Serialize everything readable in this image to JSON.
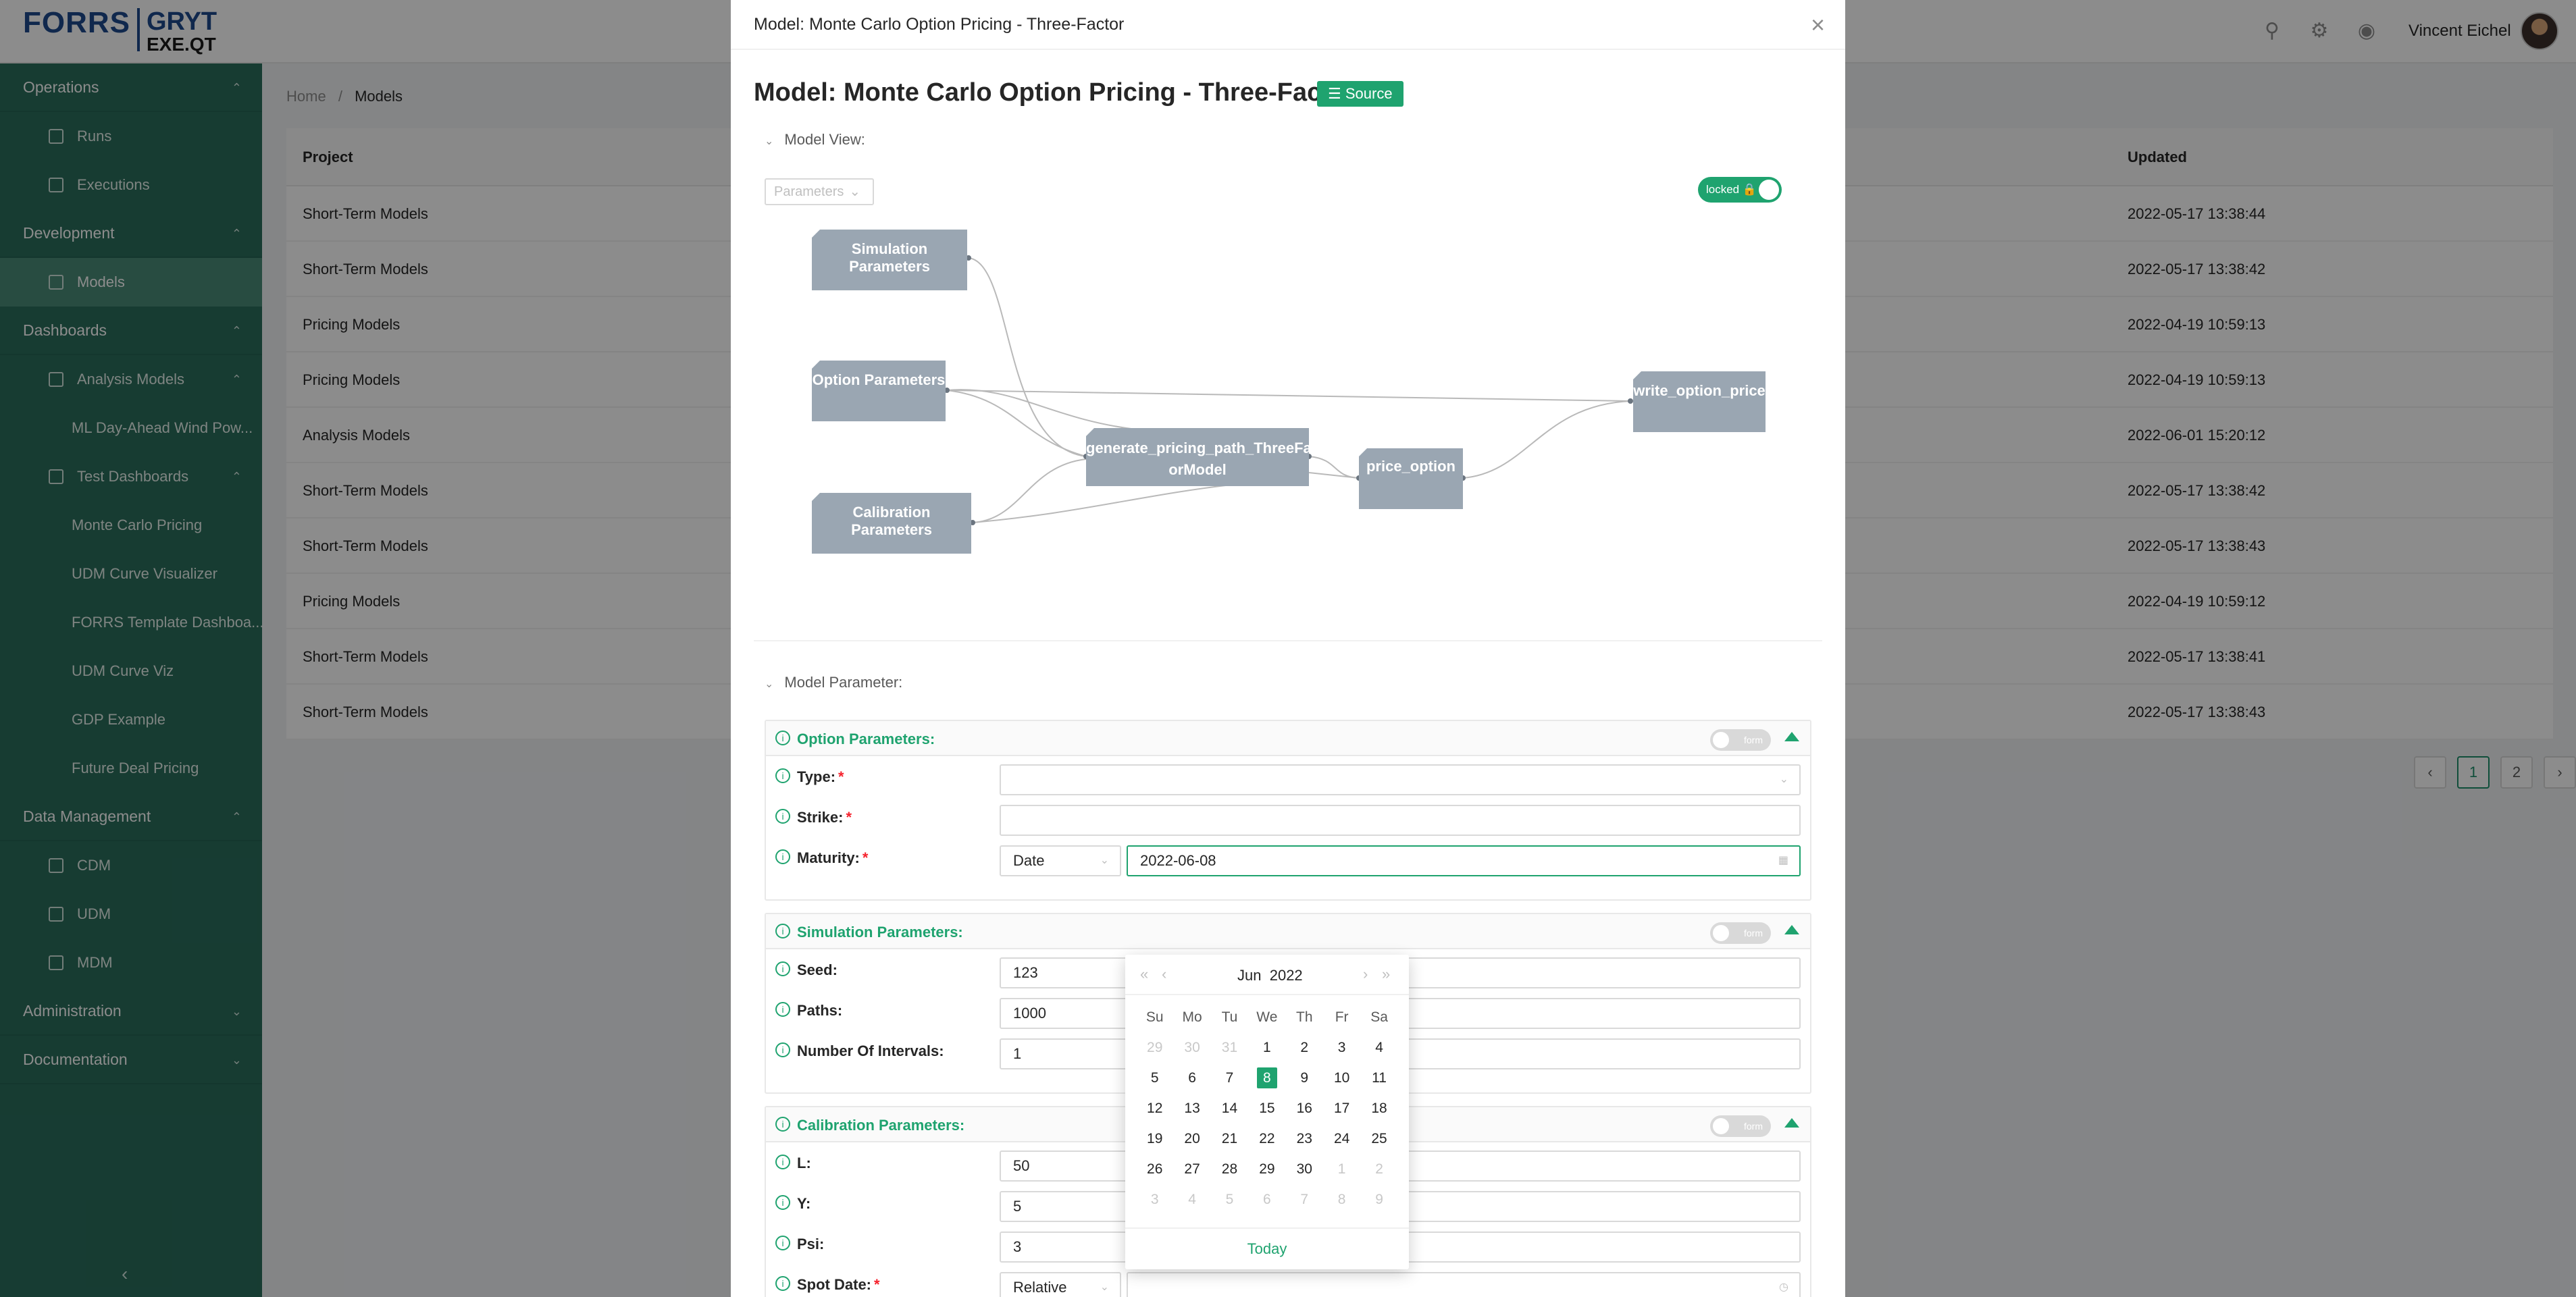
{
  "logo": {
    "brand": "FORRS",
    "sub1": "GRYT",
    "sub2": "EXE.QT"
  },
  "user": {
    "name": "Vincent Eichel"
  },
  "sidebar": {
    "operations": "Operations",
    "runs": "Runs",
    "executions": "Executions",
    "development": "Development",
    "models": "Models",
    "dashboards": "Dashboards",
    "analysis_models": "Analysis Models",
    "ml_wind": "ML Day-Ahead Wind Pow...",
    "test_dashboards": "Test Dashboards",
    "monte_carlo": "Monte Carlo Pricing",
    "udm_curve_visualizer": "UDM Curve Visualizer",
    "forrs_template": "FORRS Template Dashboa...",
    "udm_curve_viz": "UDM Curve Viz",
    "gdp_example": "GDP Example",
    "future_deal": "Future Deal Pricing",
    "data_management": "Data Management",
    "cdm": "CDM",
    "udm": "UDM",
    "mdm": "MDM",
    "administration": "Administration",
    "documentation": "Documentation"
  },
  "breadcrumb": {
    "home": "Home",
    "separator": "/",
    "current": "Models"
  },
  "table": {
    "col_project": "Project",
    "col_updated": "Updated",
    "rows": [
      {
        "project": "Short-Term Models",
        "updated": "2022-05-17 13:38:44"
      },
      {
        "project": "Short-Term Models",
        "updated": "2022-05-17 13:38:42"
      },
      {
        "project": "Pricing Models",
        "updated": "2022-04-19 10:59:13"
      },
      {
        "project": "Pricing Models",
        "updated": "2022-04-19 10:59:13"
      },
      {
        "project": "Analysis Models",
        "updated": "2022-06-01 15:20:12"
      },
      {
        "project": "Short-Term Models",
        "updated": "2022-05-17 13:38:42"
      },
      {
        "project": "Short-Term Models",
        "updated": "2022-05-17 13:38:43"
      },
      {
        "project": "Pricing Models",
        "updated": "2022-04-19 10:59:12"
      },
      {
        "project": "Short-Term Models",
        "updated": "2022-05-17 13:38:41"
      },
      {
        "project": "Short-Term Models",
        "updated": "2022-05-17 13:38:43"
      }
    ]
  },
  "pagination": {
    "page1": "1",
    "page2": "2"
  },
  "modal": {
    "header_title": "Model: Monte Carlo Option Pricing - Three-Factor",
    "title": "Model: Monte Carlo Option Pricing - Three-Factor",
    "source_label": "Source",
    "model_view_label": "Model View:",
    "parameters_dropdown": "Parameters",
    "locked_label": "locked",
    "model_parameter_label": "Model Parameter:",
    "form_toggle_label": "form"
  },
  "graph": {
    "nodes": {
      "simulation": "Simulation Parameters",
      "option": "Option Parameters",
      "calibration": "Calibration Parameters",
      "generate_l1": "generate_pricing_path_ThreeFact",
      "generate_l2": "orModel",
      "price": "price_option",
      "write": "write_option_price"
    }
  },
  "option_params": {
    "title": "Option Parameters:",
    "type_label": "Type:",
    "type_value": "",
    "strike_label": "Strike:",
    "strike_value": "",
    "maturity_label": "Maturity:",
    "maturity_mode": "Date",
    "maturity_value": "2022-06-08"
  },
  "simulation_params": {
    "title": "Simulation Parameters:",
    "seed_label": "Seed:",
    "seed_value": "123",
    "paths_label": "Paths:",
    "paths_value": "1000",
    "intervals_label": "Number Of Intervals:",
    "intervals_value": "1"
  },
  "calibration_params": {
    "title": "Calibration Parameters:",
    "l_label": "L:",
    "l_value": "50",
    "y_label": "Y:",
    "y_value": "5",
    "psi_label": "Psi:",
    "psi_value": "3",
    "spot_label": "Spot Date:",
    "spot_mode": "Relative"
  },
  "datepicker": {
    "month": "Jun",
    "year": "2022",
    "today_label": "Today",
    "weekdays": [
      "Su",
      "Mo",
      "Tu",
      "We",
      "Th",
      "Fr",
      "Sa"
    ],
    "weeks": [
      [
        "29",
        "30",
        "31",
        "1",
        "2",
        "3",
        "4"
      ],
      [
        "5",
        "6",
        "7",
        "8",
        "9",
        "10",
        "11"
      ],
      [
        "12",
        "13",
        "14",
        "15",
        "16",
        "17",
        "18"
      ],
      [
        "19",
        "20",
        "21",
        "22",
        "23",
        "24",
        "25"
      ],
      [
        "26",
        "27",
        "28",
        "29",
        "30",
        "1",
        "2"
      ],
      [
        "3",
        "4",
        "5",
        "6",
        "7",
        "8",
        "9"
      ]
    ],
    "selected": "8"
  }
}
